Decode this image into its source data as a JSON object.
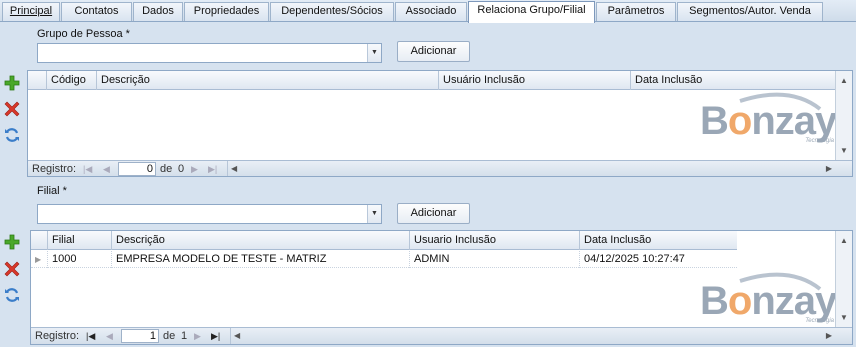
{
  "tabs": [
    {
      "label": "Principal",
      "underline": true
    },
    {
      "label": "Contatos"
    },
    {
      "label": "Dados"
    },
    {
      "label": "Propriedades"
    },
    {
      "label": "Dependentes/Sócios"
    },
    {
      "label": "Associado"
    },
    {
      "label": "Relaciona Grupo/Filial",
      "active": true
    },
    {
      "label": "Parâmetros"
    },
    {
      "label": "Segmentos/Autor. Venda"
    }
  ],
  "grupo": {
    "label": "Grupo de Pessoa *",
    "combo_value": "",
    "add_button": "Adicionar",
    "grid": {
      "columns": [
        "Código",
        "Descrição",
        "Usuário Inclusão",
        "Data Inclusão"
      ],
      "rows": []
    },
    "nav": {
      "label": "Registro:",
      "current": "0",
      "of": "de",
      "total": "0"
    }
  },
  "filial": {
    "label": "Filial *",
    "combo_value": "",
    "add_button": "Adicionar",
    "grid": {
      "columns": [
        "Filial",
        "Descrição",
        "Usuario Inclusão",
        "Data Inclusão"
      ],
      "rows": [
        {
          "filial": "1000",
          "descricao": "EMPRESA MODELO DE TESTE - MATRIZ",
          "usuario": "ADMIN",
          "data": "04/12/2025 10:27:47"
        }
      ]
    },
    "nav": {
      "label": "Registro:",
      "current": "1",
      "of": "de",
      "total": "1"
    }
  },
  "watermark": {
    "text_a": "B",
    "text_o": "o",
    "text_b": "nzay",
    "sub": "Tecnologia"
  },
  "colors": {
    "accent_add": "#4aa829",
    "accent_remove": "#d9382b",
    "accent_refresh": "#3a7dc9"
  },
  "icons": [
    "add-icon",
    "remove-icon",
    "refresh-icon"
  ]
}
